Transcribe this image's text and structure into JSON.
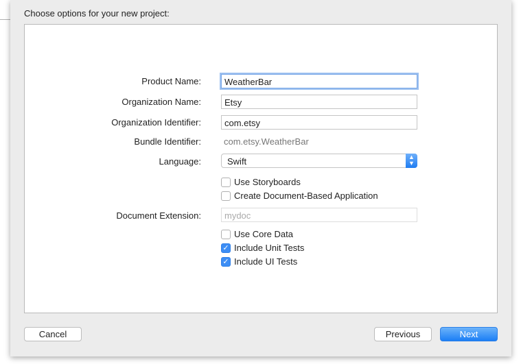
{
  "title": "Choose options for your new project:",
  "form": {
    "product_name": {
      "label": "Product Name:",
      "value": "WeatherBar"
    },
    "organization_name": {
      "label": "Organization Name:",
      "value": "Etsy"
    },
    "organization_identifier": {
      "label": "Organization Identifier:",
      "value": "com.etsy"
    },
    "bundle_identifier": {
      "label": "Bundle Identifier:",
      "value": "com.etsy.WeatherBar"
    },
    "language": {
      "label": "Language:",
      "value": "Swift"
    },
    "use_storyboards": {
      "label": "Use Storyboards",
      "checked": false
    },
    "document_based": {
      "label": "Create Document-Based Application",
      "checked": false
    },
    "document_extension": {
      "label": "Document Extension:",
      "placeholder": "mydoc"
    },
    "use_core_data": {
      "label": "Use Core Data",
      "checked": false
    },
    "unit_tests": {
      "label": "Include Unit Tests",
      "checked": true
    },
    "ui_tests": {
      "label": "Include UI Tests",
      "checked": true
    }
  },
  "buttons": {
    "cancel": "Cancel",
    "previous": "Previous",
    "next": "Next"
  },
  "accent": "#1b7ef5"
}
